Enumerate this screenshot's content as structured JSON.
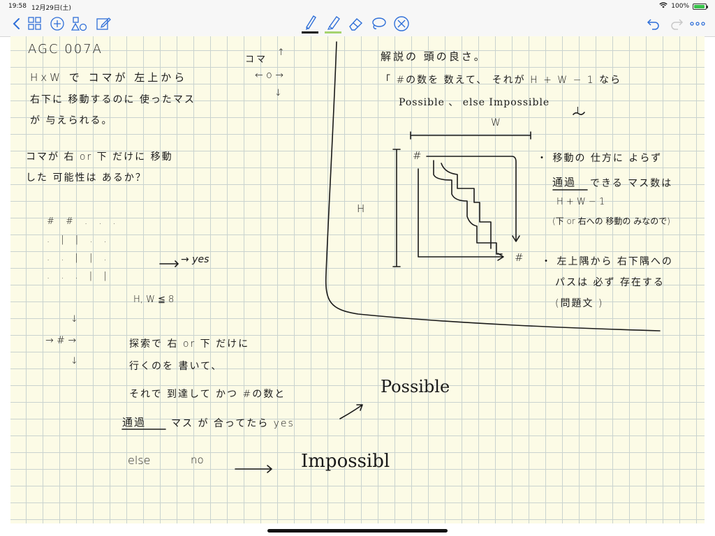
{
  "status": {
    "time": "19:58",
    "date": "12月29日(土)",
    "battery": "100%"
  },
  "icons": {
    "toolbar_left": [
      "back-icon",
      "thumbnails-icon",
      "add-icon",
      "shapes-icon",
      "edit-icon"
    ],
    "toolbar_center": [
      "pen-icon",
      "highlighter-icon",
      "eraser-icon",
      "lasso-icon",
      "close-circle-icon"
    ],
    "toolbar_right": [
      "undo-icon",
      "redo-icon",
      "more-icon"
    ]
  },
  "colors": {
    "accent": "#2f6fd8",
    "pen": "#111111",
    "highlighter": "#a6d36f",
    "paper": "#fcfbe6",
    "grid": "#c9d3cf"
  },
  "notes": {
    "left": {
      "title": "AGC 007A",
      "problem_line1": "HxW で コマが 左上から",
      "problem_line2": "右下に 移動するのに 使ったマス",
      "problem_line3": "が 与えられる。",
      "question_line1": "コマが 右 or 下 だけに 移動",
      "question_line2": "した 可能性は あるか？",
      "grid_row1": "#  #  .  .  .",
      "grid_row2": ".  |  |  .  .",
      "grid_row3": ".  .  |  |  .",
      "grid_row4": ".  .  .  |  |",
      "yes": "→ yes",
      "constraint": "H, W ≦ 8",
      "arrow_down_top": "↓",
      "arrow_hash": "→  #  →",
      "arrow_down_bottom": "↓",
      "search_line1": "探索で 右 or 下 だけに",
      "search_line2": "行くのを 書いて、",
      "search_line3": "それで 到達して かつ #の数と",
      "search_line4_a": "通過",
      "search_line4_b": "マス が 合ってたら yes",
      "possible": "Possible",
      "else": "else",
      "no": "no",
      "impossible": "Impossibl",
      "koma_label": "コマ",
      "koma_center": "←  o  →",
      "koma_up": "↑",
      "koma_down": "↓"
    },
    "right": {
      "solution_title": "解説の 頭の良さ。",
      "solution_line1": "「 #の数を 数えて、 それが H + W − 1 なら",
      "solution_line2": "Possible 、 else Impossible",
      "solution_end": "」",
      "w_label": "W",
      "h_label": "H",
      "hash_top": "#",
      "hash_bottom": "#",
      "note1_line1": "・ 移動の 仕方に よらず",
      "note1_line2_a": "通過",
      "note1_line2_b": "できる マス数は",
      "note1_line3": "H + W − 1",
      "note1_line4": "(下 or 右への 移動の みなので)",
      "note2_line1": "・ 左上隅から 右下隅への",
      "note2_line2": "パスは 必ず 存在する",
      "note2_line3": "(問題文 )"
    }
  }
}
